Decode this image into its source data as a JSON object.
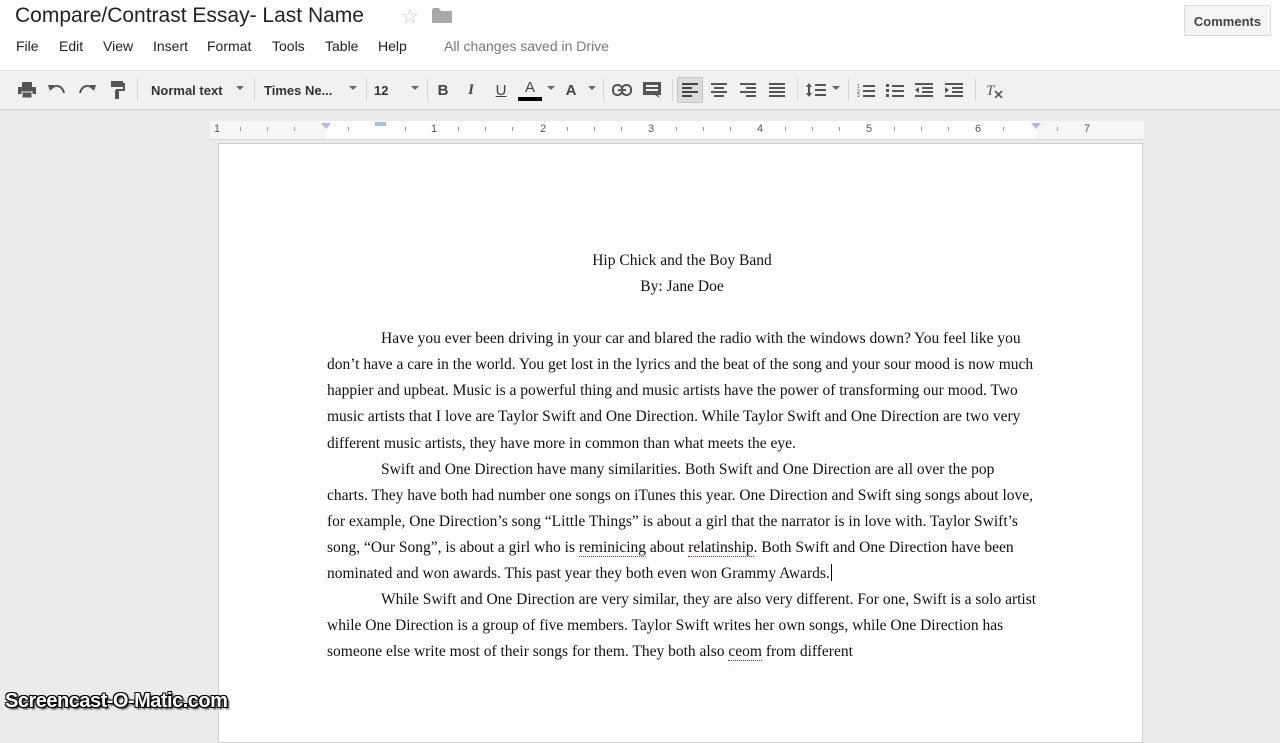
{
  "doc_title": "Compare/Contrast Essay- Last Name",
  "comments_label": "Comments",
  "menu": [
    "File",
    "Edit",
    "View",
    "Insert",
    "Format",
    "Tools",
    "Table",
    "Help"
  ],
  "save_status": "All changes saved in Drive",
  "toolbar": {
    "style": "Normal text",
    "font": "Times Ne...",
    "size": "12",
    "bold": "B",
    "italic": "I",
    "underline": "U",
    "text_color": "A",
    "highlight": "A"
  },
  "ruler": {
    "labels": [
      "1",
      "1",
      "2",
      "3",
      "4",
      "5",
      "6",
      "7"
    ]
  },
  "doc": {
    "title": "Hip Chick and the Boy Band",
    "byline": "By: Jane Doe",
    "p1": "Have you ever been driving in your car and blared the radio with the windows down?  You feel like you don’t have a care in the world.  You get lost in the lyrics and the beat of the song and your sour mood is now much happier and upbeat.  Music is a powerful thing and music artists have the power of transforming our mood.  Two music artists that I love are Taylor Swift and One Direction.  While Taylor Swift and One Direction are two very different music artists, they have more in common than what meets the eye.",
    "p2a": "Swift and One Direction have many similarities. Both Swift and One Direction are all over the pop charts.  They have both had number one songs on iTunes this year.  One Direction and Swift sing songs about love, for example, One Direction’s song “Little Things” is about a girl that the narrator is in love with.  Taylor Swift’s song, “Our Song”, is about a girl who is ",
    "p2_miss1": "reminicing",
    "p2b": " about ",
    "p2_miss2": "relatinship",
    "p2c": ".  Both Swift and One Direction have been nominated and won awards.  This past year they both even won Grammy Awards.",
    "p3a": "While Swift and One Direction are very similar, they are also very different.  For one, Swift is a solo artist while One Direction is a group of five members.  Taylor Swift writes her own songs, while One Direction has someone else write most of their songs for them.  They both also ",
    "p3_miss": "ceom",
    "p3b": " from different"
  },
  "watermark": "Screencast-O-Matic.com",
  "colors": {
    "text_color_bar": "#000000",
    "ruler_marker": "#a5c0e8"
  }
}
